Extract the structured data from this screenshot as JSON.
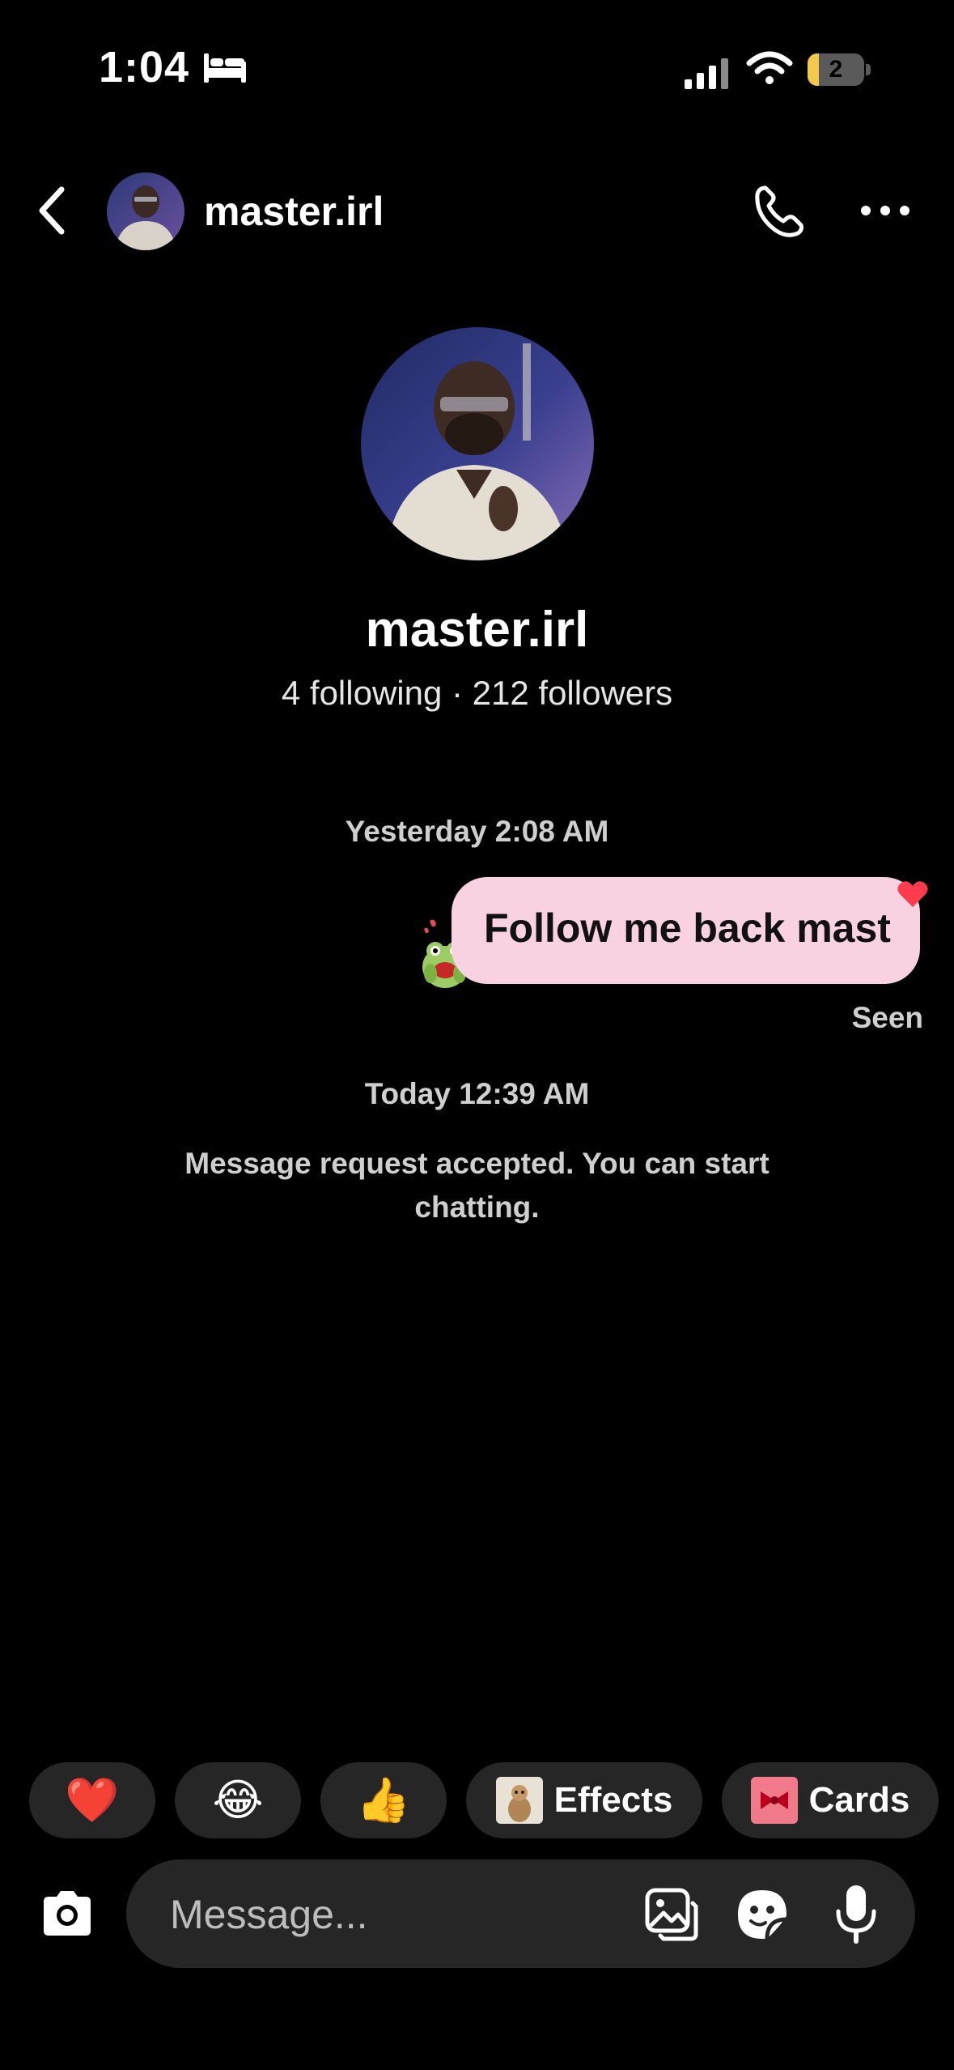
{
  "status_bar": {
    "time": "1:04",
    "battery_level": "2",
    "battery_fraction": 0.2,
    "icons": [
      "bed-icon",
      "signal-icon",
      "wifi-icon",
      "battery-icon"
    ]
  },
  "header": {
    "username": "master.irl",
    "icons": [
      "back-icon",
      "phone-icon",
      "more-icon"
    ]
  },
  "profile": {
    "username": "master.irl",
    "stats": "4 following · 212 followers"
  },
  "messages": {
    "timestamp_1": "Yesterday 2:08 AM",
    "sent_message": "Follow me back mast",
    "receipt": "Seen",
    "timestamp_2": "Today 12:39 AM",
    "system_message": "Message request accepted. You can start chatting."
  },
  "quick_reactions": {
    "heart": "❤️",
    "laugh": "😂",
    "thumbs": "👍",
    "effects_label": "Effects",
    "cards_label": "Cards"
  },
  "composer": {
    "placeholder": "Message...",
    "value": "",
    "icons": [
      "camera-icon",
      "gallery-icon",
      "sticker-icon",
      "mic-icon"
    ]
  },
  "colors": {
    "background": "#000000",
    "bubble": "#f8d2e0",
    "chip": "#262626",
    "muted_text": "#cfcfcf"
  }
}
